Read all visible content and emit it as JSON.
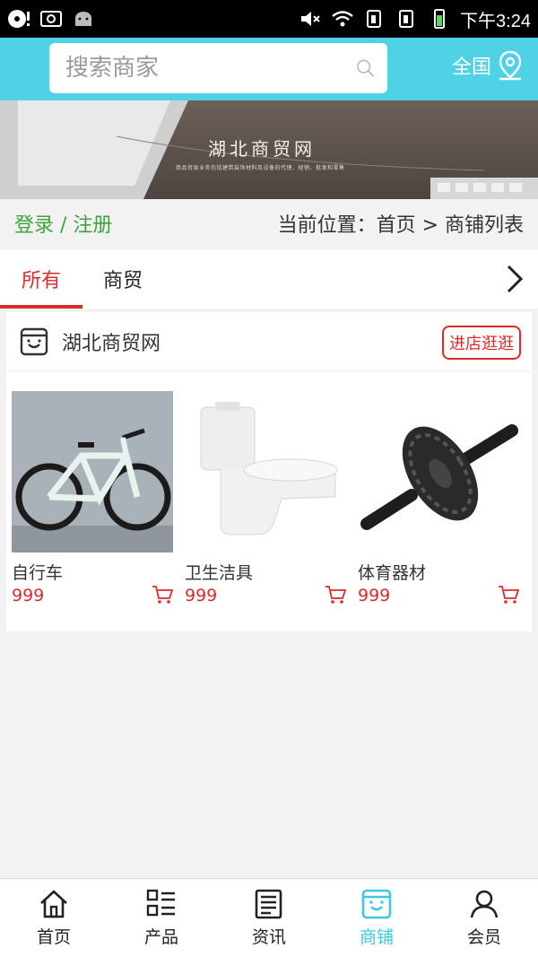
{
  "status_bar": {
    "time": "下午3:24"
  },
  "header": {
    "search_placeholder": "搜索商家",
    "region_label": "全国"
  },
  "banner": {
    "title": "湖北商贸网",
    "subtitle": "商品贸易业务包括建筑装饰材料及设备的代理、经销、批发和零售"
  },
  "breadcrumb": {
    "login_label": "登录 / 注册",
    "location_label": "当前位置：首页 > 商铺列表"
  },
  "tabs": [
    {
      "label": "所有",
      "active": true
    },
    {
      "label": "商贸",
      "active": false
    }
  ],
  "store": {
    "name": "湖北商贸网",
    "enter_label": "进店逛逛",
    "products": [
      {
        "name": "自行车",
        "price": "999"
      },
      {
        "name": "卫生洁具",
        "price": "999"
      },
      {
        "name": "体育器材",
        "price": "999"
      }
    ]
  },
  "bottom_nav": [
    {
      "label": "首页",
      "icon": "home-icon",
      "active": false
    },
    {
      "label": "产品",
      "icon": "product-list-icon",
      "active": false
    },
    {
      "label": "资讯",
      "icon": "news-icon",
      "active": false
    },
    {
      "label": "商铺",
      "icon": "store-icon",
      "active": true
    },
    {
      "label": "会员",
      "icon": "member-icon",
      "active": false
    }
  ],
  "colors": {
    "accent": "#4fd1e6",
    "nav_active": "#3ec8df",
    "highlight_red": "#d82c2c",
    "login_green": "#3fa33c"
  }
}
